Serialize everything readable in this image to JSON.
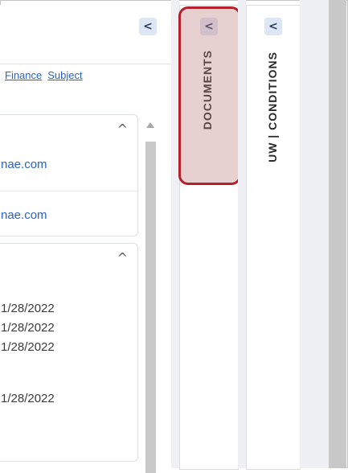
{
  "left_panel": {
    "collapse_glyph": "<",
    "links": [
      "Finance",
      "Subject"
    ],
    "card1": {
      "caret": "^",
      "emails": [
        "nae.com",
        "nae.com"
      ]
    },
    "card2": {
      "caret": "^",
      "dates": [
        "1/28/2022",
        "1/28/2022",
        "1/28/2022",
        "1/28/2022"
      ]
    }
  },
  "tabs": {
    "documents": {
      "label": "DOCUMENTS",
      "collapse_glyph": "<",
      "highlighted": true
    },
    "uw_conditions": {
      "label": "UW | CONDITIONS",
      "collapse_glyph": "<"
    }
  },
  "colors": {
    "highlight": "#b5202a",
    "link": "#2a63c8",
    "button_bg": "#dde6f5"
  }
}
